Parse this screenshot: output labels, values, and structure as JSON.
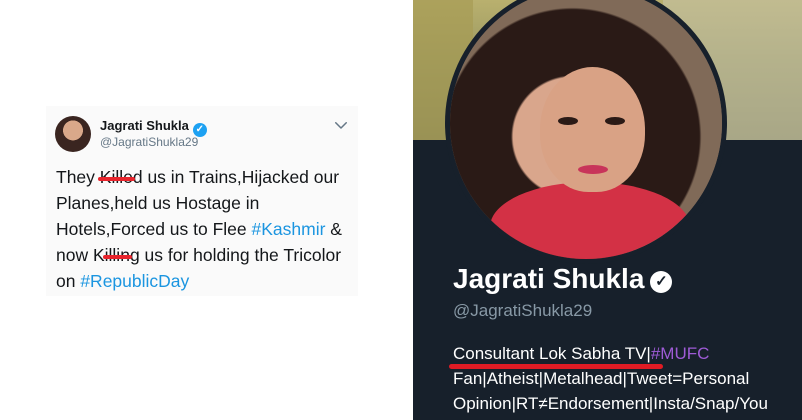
{
  "tweet": {
    "name": "Jagrati Shukla",
    "handle": "@JagratiShukla29",
    "text_parts": {
      "p1": "They ",
      "s1": "Kille",
      "p2": "d us in Trains,Hijacked our Planes,held us Hostage in Hotels,Forced us to Flee ",
      "tag1": "#Kashmir",
      "p3": " & now K",
      "s2": "illin",
      "p4": "g us for holding the Tricolor on ",
      "tag2": "#RepublicDay"
    },
    "verified_glyph": "✓",
    "chevron_icon": "chevron-down-icon"
  },
  "profile": {
    "name": "Jagrati Shukla",
    "handle": "@JagratiShukla29",
    "verified_glyph": "✓",
    "bio": {
      "line1_text": "Consultant Lok Sabha TV|",
      "line1_tag": "#MUFC",
      "line2": "Fan|Atheist|Metalhead|Tweet=Personal",
      "line3": "Opinion|RT≠Endorsement|Insta/Snap/You"
    }
  },
  "colors": {
    "tweet_link": "#1b95e0",
    "strike_red": "#e8242c",
    "profile_bg": "#17202b",
    "hashtag_purple": "#9e5bd6",
    "underline_red": "#e01b24"
  }
}
